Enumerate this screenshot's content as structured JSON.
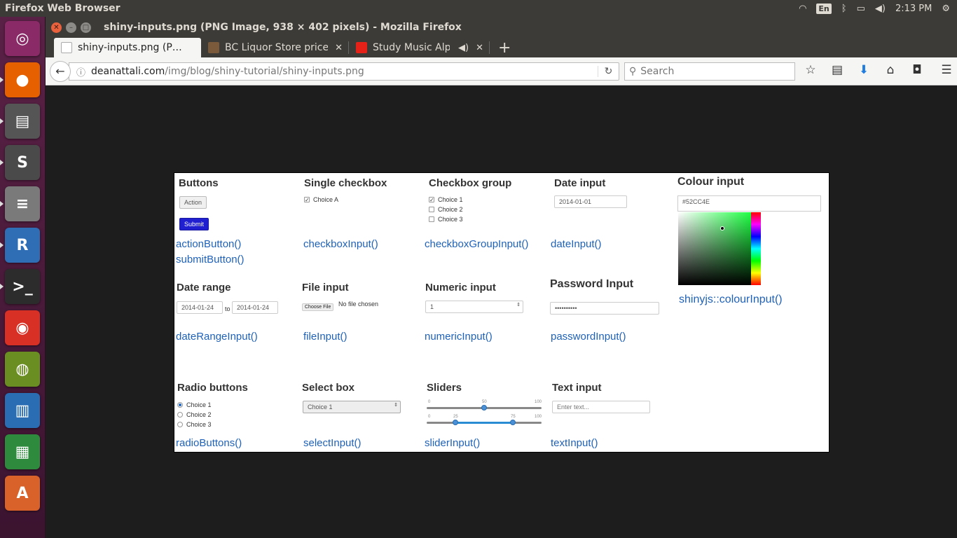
{
  "panel": {
    "app_title": "Firefox Web Browser",
    "keyboard": "En",
    "time": "2:13 PM"
  },
  "launcher": {
    "items": [
      {
        "name": "ubuntu-dash",
        "glyph": "◎",
        "color": "#8a2b68"
      },
      {
        "name": "firefox",
        "glyph": "●",
        "color": "#e66000"
      },
      {
        "name": "files",
        "glyph": "▤",
        "color": "#555555"
      },
      {
        "name": "sublime-text",
        "glyph": "S",
        "color": "#4a4a4a"
      },
      {
        "name": "database",
        "glyph": "≡",
        "color": "#7a7a7a"
      },
      {
        "name": "r-language",
        "glyph": "R",
        "color": "#2f6db5"
      },
      {
        "name": "terminal",
        "glyph": ">_",
        "color": "#2c2c2c"
      },
      {
        "name": "chrome",
        "glyph": "◉",
        "color": "#d93025"
      },
      {
        "name": "image-viewer",
        "glyph": "◍",
        "color": "#6b8e23"
      },
      {
        "name": "writer",
        "glyph": "▥",
        "color": "#2a6db3"
      },
      {
        "name": "calc",
        "glyph": "▦",
        "color": "#2e8b3d"
      },
      {
        "name": "impress",
        "glyph": "A",
        "color": "#d9622b"
      },
      {
        "name": "text-editor",
        "glyph": "✎",
        "color": "#c0c0c0"
      }
    ]
  },
  "window": {
    "title": "shiny-inputs.png (PNG Image, 938 × 402 pixels) - Mozilla Firefox"
  },
  "tabs": [
    {
      "label": "shiny-inputs.png (P…",
      "active": true
    },
    {
      "label": "BC Liquor Store prices",
      "active": false
    },
    {
      "label": "Study Music Alp…",
      "active": false
    }
  ],
  "nav": {
    "url_host": "deanattali.com",
    "url_path": "/img/blog/shiny-tutorial/shiny-inputs.png",
    "search_placeholder": "Search"
  },
  "shot": {
    "row1": {
      "buttons": {
        "heading": "Buttons",
        "action": "Action",
        "submit": "Submit",
        "fn1": "actionButton()",
        "fn2": "submitButton()"
      },
      "single": {
        "heading": "Single checkbox",
        "choice": "Choice A",
        "fn": "checkboxInput()"
      },
      "group": {
        "heading": "Checkbox group",
        "c1": "Choice 1",
        "c2": "Choice 2",
        "c3": "Choice 3",
        "fn": "checkboxGroupInput()"
      },
      "date": {
        "heading": "Date input",
        "value": "2014-01-01",
        "fn": "dateInput()"
      },
      "colour": {
        "heading": "Colour input",
        "value": "#52CC4E",
        "swatch": "#00e04a",
        "fn": "shinyjs::colourInput()"
      }
    },
    "row2": {
      "daterange": {
        "heading": "Date range",
        "from": "2014-01-24",
        "sep": "to",
        "to": "2014-01-24",
        "fn": "dateRangeInput()"
      },
      "file": {
        "heading": "File input",
        "button": "Choose File",
        "status": "No file chosen",
        "fn": "fileInput()"
      },
      "numeric": {
        "heading": "Numeric input",
        "value": "1",
        "fn": "numericInput()"
      },
      "password": {
        "heading": "Password Input",
        "value": "••••••••••",
        "fn": "passwordInput()"
      }
    },
    "row3": {
      "radio": {
        "heading": "Radio buttons",
        "c1": "Choice 1",
        "c2": "Choice 2",
        "c3": "Choice 3",
        "fn": "radioButtons()"
      },
      "select": {
        "heading": "Select box",
        "value": "Choice 1",
        "fn": "selectInput()"
      },
      "sliders": {
        "heading": "Sliders",
        "s1_min": "0",
        "s1_val": "50",
        "s1_max": "100",
        "s2_min": "0",
        "s2_lo": "25",
        "s2_hi": "75",
        "s2_max": "100",
        "fn": "sliderInput()"
      },
      "text": {
        "heading": "Text input",
        "placeholder": "Enter text...",
        "fn": "textInput()"
      }
    },
    "slider_values": {
      "single": 50,
      "range": [
        25,
        75
      ],
      "min": 0,
      "max": 100
    }
  }
}
